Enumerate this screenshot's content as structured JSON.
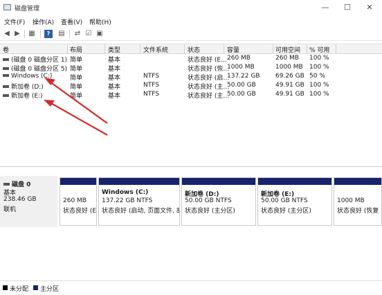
{
  "title": "磁盘管理",
  "window_buttons": {
    "minimize": "—",
    "maximize": "☐",
    "close": "✕"
  },
  "menu": [
    "文件(F)",
    "操作(A)",
    "查看(V)",
    "帮助(H)"
  ],
  "toolbar_icons": [
    "back-icon",
    "forward-icon",
    "volume-list-icon",
    "help-icon",
    "connect-icon",
    "rescan-icon",
    "properties-icon"
  ],
  "columns": [
    "卷",
    "布局",
    "类型",
    "文件系统",
    "状态",
    "容量",
    "可用空间",
    "% 可用"
  ],
  "volumes": [
    {
      "name": "(磁盘 0 磁盘分区 1)",
      "layout": "简单",
      "type": "基本",
      "fs": "",
      "status": "状态良好 (E…",
      "capacity": "260 MB",
      "free": "260 MB",
      "pct": "100 %"
    },
    {
      "name": "(磁盘 0 磁盘分区 5)",
      "layout": "简单",
      "type": "基本",
      "fs": "",
      "status": "状态良好 (恢…",
      "capacity": "1000 MB",
      "free": "1000 MB",
      "pct": "100 %"
    },
    {
      "name": "Windows (C:)",
      "layout": "简单",
      "type": "基本",
      "fs": "NTFS",
      "status": "状态良好 (启…",
      "capacity": "137.22 GB",
      "free": "69.26 GB",
      "pct": "50 %"
    },
    {
      "name": "新加卷 (D:)",
      "layout": "简单",
      "type": "基本",
      "fs": "NTFS",
      "status": "状态良好 (主…",
      "capacity": "50.00 GB",
      "free": "49.91 GB",
      "pct": "100 %"
    },
    {
      "name": "新加卷 (E:)",
      "layout": "简单",
      "type": "基本",
      "fs": "NTFS",
      "status": "状态良好 (主…",
      "capacity": "50.00 GB",
      "free": "49.91 GB",
      "pct": "100 %"
    }
  ],
  "disk": {
    "name": "磁盘 0",
    "type": "基本",
    "size": "238.46 GB",
    "state": "联机"
  },
  "partitions": [
    {
      "title": "",
      "size": "260 MB",
      "status": "状态良好 (E"
    },
    {
      "title": "Windows  (C:)",
      "size": "137.22 GB NTFS",
      "status": "状态良好 (启动, 页面文件, 故"
    },
    {
      "title": "新加卷  (D:)",
      "size": "50.00 GB NTFS",
      "status": "状态良好 (主分区)"
    },
    {
      "title": "新加卷  (E:)",
      "size": "50.00 GB NTFS",
      "status": "状态良好 (主分区)"
    },
    {
      "title": "",
      "size": "1000 MB",
      "status": "状态良好 (恢复"
    }
  ],
  "legend": [
    {
      "label": "未分配",
      "color": "#000000"
    },
    {
      "label": "主分区",
      "color": "#17236e"
    }
  ],
  "colors": {
    "partition_bar": "#17236e",
    "arrow": "#d42a2a"
  }
}
